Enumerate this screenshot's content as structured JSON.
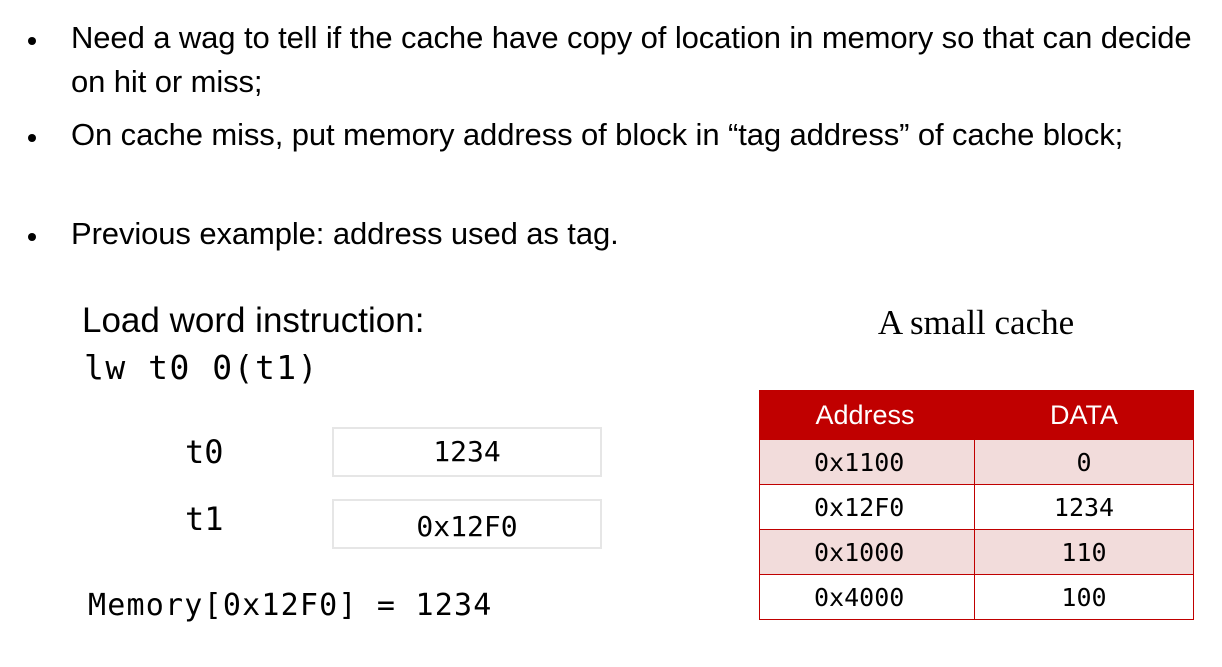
{
  "bullets": [
    "Need a wag to tell if the cache have copy of location in memory so that can decide on hit or miss;",
    "On cache miss, put memory address of block in “tag address” of cache block;",
    "Previous example: address used as tag."
  ],
  "instruction": {
    "heading": "Load word instruction:",
    "code": "lw t0 0(t1)"
  },
  "registers": [
    {
      "name": "t0",
      "value": "1234"
    },
    {
      "name": "t1",
      "value": "0x12F0"
    }
  ],
  "memory_statement": "Memory[0x12F0] = 1234",
  "cache": {
    "caption": "A small cache",
    "headers": [
      "Address",
      "DATA"
    ],
    "rows": [
      {
        "address": "0x1100",
        "data": "0"
      },
      {
        "address": "0x12F0",
        "data": "1234"
      },
      {
        "address": "0x1000",
        "data": "110"
      },
      {
        "address": "0x4000",
        "data": "100"
      }
    ],
    "colors": {
      "header_bg": "#c00000",
      "header_text": "#ffffff",
      "row_shade": "#f2dcdb",
      "border": "#c00000"
    }
  }
}
